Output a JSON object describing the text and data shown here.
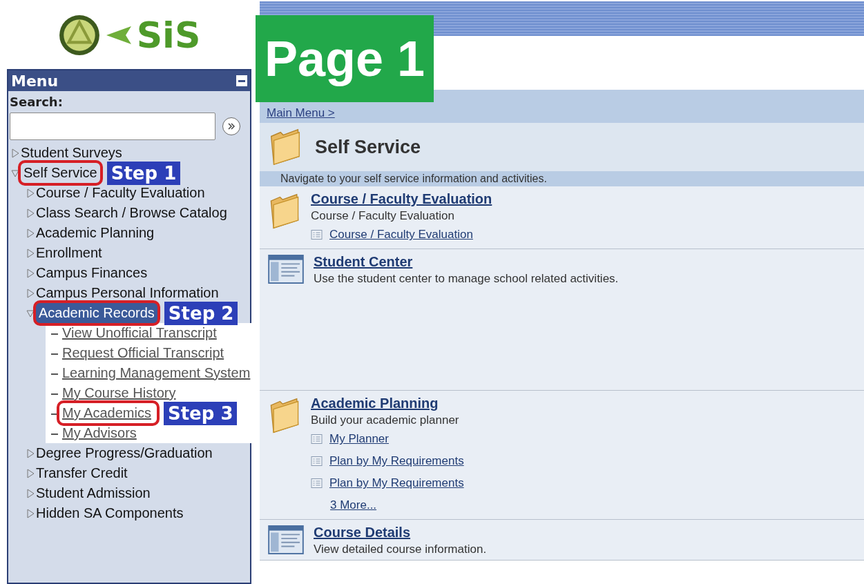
{
  "logo": {
    "text": "SiS"
  },
  "overlay": {
    "text": "Page 1"
  },
  "menu": {
    "title": "Menu",
    "search_label": "Search:",
    "items": [
      {
        "kind": "folder",
        "label": "Student Surveys",
        "expanded": false
      },
      {
        "kind": "folder",
        "label": "Self Service",
        "expanded": true,
        "annotation": "Step 1",
        "children": [
          {
            "kind": "folder",
            "label": "Course / Faculty Evaluation",
            "expanded": false
          },
          {
            "kind": "folder",
            "label": "Class Search / Browse Catalog",
            "expanded": false
          },
          {
            "kind": "folder",
            "label": "Academic Planning",
            "expanded": false
          },
          {
            "kind": "folder",
            "label": "Enrollment",
            "expanded": false
          },
          {
            "kind": "folder",
            "label": "Campus Finances",
            "expanded": false
          },
          {
            "kind": "folder",
            "label": "Campus Personal Information",
            "expanded": false
          },
          {
            "kind": "folder",
            "label": "Academic Records",
            "expanded": true,
            "selected": true,
            "annotation": "Step 2",
            "children": [
              {
                "kind": "link",
                "label": "View Unofficial Transcript"
              },
              {
                "kind": "link",
                "label": "Request Official Transcript"
              },
              {
                "kind": "link",
                "label": "Learning Management System"
              },
              {
                "kind": "link",
                "label": "My Course History"
              },
              {
                "kind": "link",
                "label": "My Academics",
                "annotation": "Step 3"
              },
              {
                "kind": "link",
                "label": "My Advisors"
              }
            ]
          },
          {
            "kind": "folder",
            "label": "Degree Progress/Graduation",
            "expanded": false
          },
          {
            "kind": "folder",
            "label": "Transfer Credit",
            "expanded": false
          },
          {
            "kind": "folder",
            "label": "Student Admission",
            "expanded": false
          },
          {
            "kind": "folder",
            "label": "Hidden SA Components",
            "expanded": false
          }
        ]
      }
    ]
  },
  "breadcrumb": "Main Menu >",
  "page": {
    "title": "Self Service",
    "description": "Navigate to your self service information and activities."
  },
  "sections": [
    {
      "kind": "folder",
      "title": "Course / Faculty Evaluation",
      "description": "Course / Faculty Evaluation",
      "links": [
        "Course / Faculty Evaluation"
      ]
    },
    {
      "kind": "component",
      "title": "Student Center",
      "description": "Use the student center to manage school related activities."
    },
    {
      "kind": "folder",
      "title": "Academic Planning",
      "description": "Build your academic planner",
      "links": [
        "My Planner",
        "Plan by My Requirements",
        "Plan by My Requirements"
      ],
      "more": "3 More..."
    },
    {
      "kind": "component",
      "title": "Course Details",
      "description": "View detailed course information."
    }
  ]
}
